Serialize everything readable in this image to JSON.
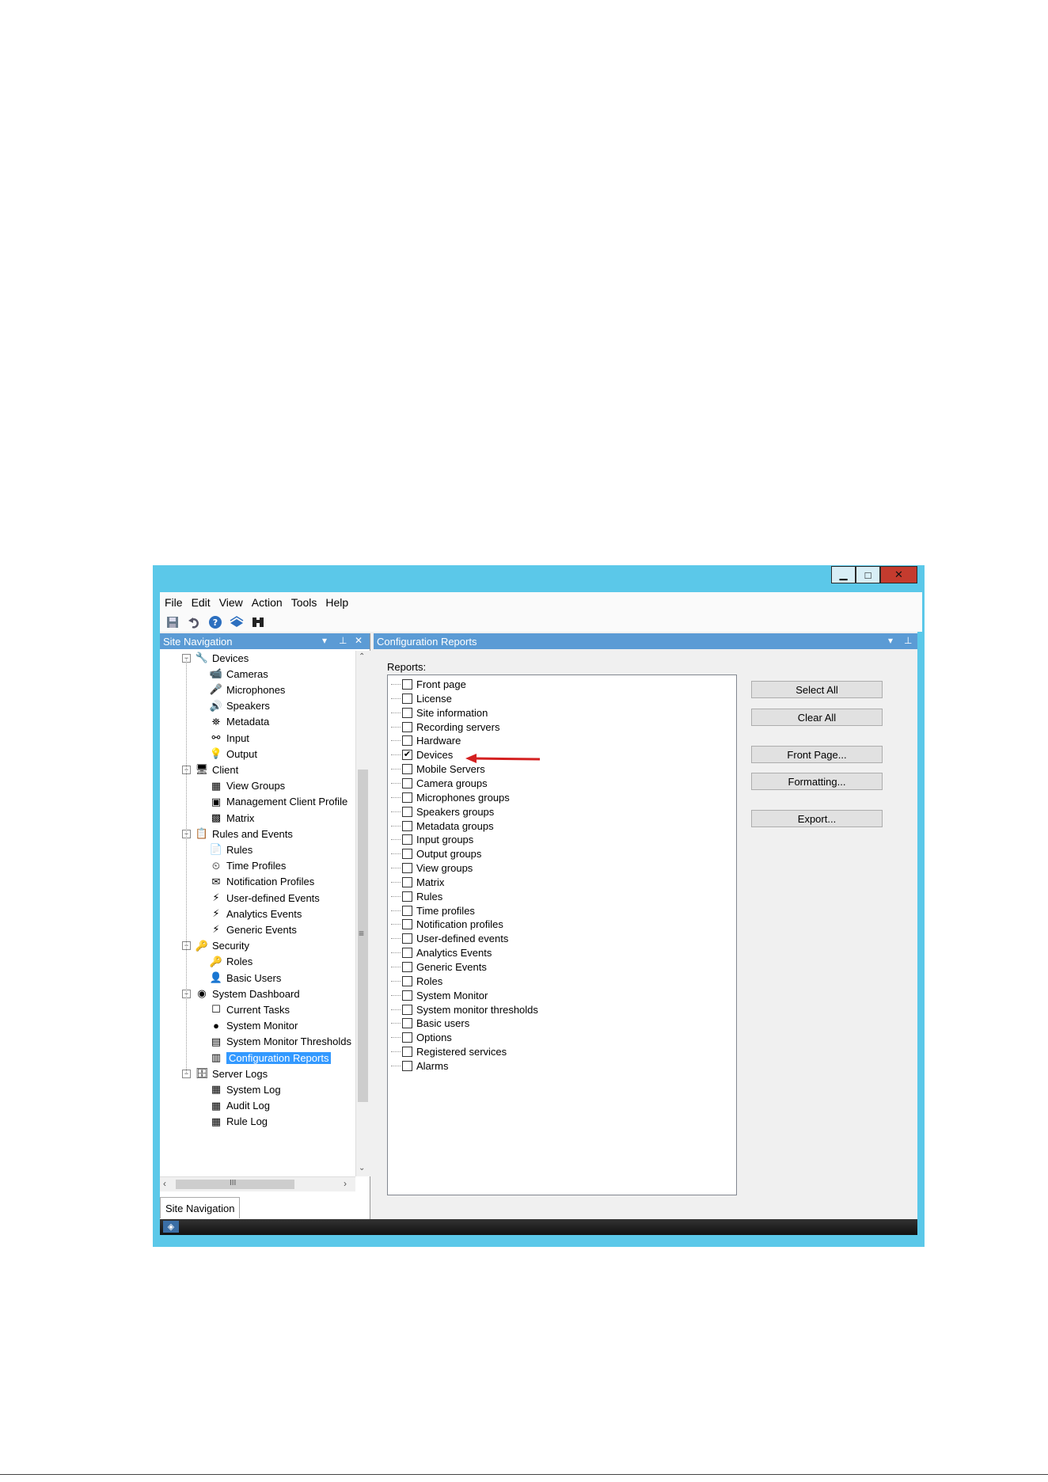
{
  "menu": [
    "File",
    "Edit",
    "View",
    "Action",
    "Tools",
    "Help"
  ],
  "window_controls": {
    "minimize": "▁",
    "maximize": "□",
    "close": "✕"
  },
  "left_pane": {
    "title": "Site Navigation",
    "tab_label": "Site Navigation",
    "tree": [
      {
        "label": "Devices",
        "level": 1,
        "icon": "devices-icon",
        "glyph": "🔧",
        "expander": "−"
      },
      {
        "label": "Cameras",
        "level": 2,
        "icon": "camera-icon",
        "glyph": "📹"
      },
      {
        "label": "Microphones",
        "level": 2,
        "icon": "microphone-icon",
        "glyph": "🎤"
      },
      {
        "label": "Speakers",
        "level": 2,
        "icon": "speaker-icon",
        "glyph": "🔊"
      },
      {
        "label": "Metadata",
        "level": 2,
        "icon": "metadata-icon",
        "glyph": "⛯"
      },
      {
        "label": "Input",
        "level": 2,
        "icon": "input-icon",
        "glyph": "⚯"
      },
      {
        "label": "Output",
        "level": 2,
        "icon": "output-icon",
        "glyph": "💡"
      },
      {
        "label": "Client",
        "level": 1,
        "icon": "client-icon",
        "glyph": "🖥",
        "expander": "−"
      },
      {
        "label": "View Groups",
        "level": 2,
        "icon": "view-groups-icon",
        "glyph": "▦"
      },
      {
        "label": "Management Client Profile",
        "level": 2,
        "icon": "management-client-profile-icon",
        "glyph": "▣"
      },
      {
        "label": "Matrix",
        "level": 2,
        "icon": "matrix-icon",
        "glyph": "▩"
      },
      {
        "label": "Rules and Events",
        "level": 1,
        "icon": "rules-events-icon",
        "glyph": "📋",
        "expander": "−"
      },
      {
        "label": "Rules",
        "level": 2,
        "icon": "rules-icon",
        "glyph": "📄"
      },
      {
        "label": "Time Profiles",
        "level": 2,
        "icon": "time-profiles-icon",
        "glyph": "⏲"
      },
      {
        "label": "Notification Profiles",
        "level": 2,
        "icon": "notification-profiles-icon",
        "glyph": "✉"
      },
      {
        "label": "User-defined Events",
        "level": 2,
        "icon": "user-defined-events-icon",
        "glyph": "⚡"
      },
      {
        "label": "Analytics Events",
        "level": 2,
        "icon": "analytics-events-icon",
        "glyph": "⚡"
      },
      {
        "label": "Generic Events",
        "level": 2,
        "icon": "generic-events-icon",
        "glyph": "⚡"
      },
      {
        "label": "Security",
        "level": 1,
        "icon": "security-icon",
        "glyph": "🔑",
        "expander": "−"
      },
      {
        "label": "Roles",
        "level": 2,
        "icon": "roles-icon",
        "glyph": "🔑"
      },
      {
        "label": "Basic Users",
        "level": 2,
        "icon": "basic-users-icon",
        "glyph": "👤"
      },
      {
        "label": "System Dashboard",
        "level": 1,
        "icon": "system-dashboard-icon",
        "glyph": "◉",
        "expander": "−"
      },
      {
        "label": "Current Tasks",
        "level": 2,
        "icon": "current-tasks-icon",
        "glyph": "☐"
      },
      {
        "label": "System Monitor",
        "level": 2,
        "icon": "system-monitor-icon",
        "glyph": "●"
      },
      {
        "label": "System Monitor Thresholds",
        "level": 2,
        "icon": "system-monitor-thresholds-icon",
        "glyph": "▤"
      },
      {
        "label": "Configuration Reports",
        "level": 2,
        "icon": "configuration-reports-icon",
        "glyph": "▥",
        "selected": true
      },
      {
        "label": "Server Logs",
        "level": 1,
        "icon": "server-logs-icon",
        "glyph": "🗄",
        "expander": "−"
      },
      {
        "label": "System Log",
        "level": 2,
        "icon": "system-log-icon",
        "glyph": "▦"
      },
      {
        "label": "Audit Log",
        "level": 2,
        "icon": "audit-log-icon",
        "glyph": "▦"
      },
      {
        "label": "Rule Log",
        "level": 2,
        "icon": "rule-log-icon",
        "glyph": "▦"
      }
    ],
    "hscroll_grip": "III",
    "vscroll_grip": "≡"
  },
  "right_pane": {
    "title": "Configuration Reports",
    "reports_label": "Reports:",
    "reports": [
      {
        "label": "Front page",
        "checked": false
      },
      {
        "label": "License",
        "checked": false
      },
      {
        "label": "Site information",
        "checked": false
      },
      {
        "label": "Recording servers",
        "checked": false
      },
      {
        "label": "Hardware",
        "checked": false
      },
      {
        "label": "Devices",
        "checked": true
      },
      {
        "label": "Mobile Servers",
        "checked": false
      },
      {
        "label": "Camera groups",
        "checked": false
      },
      {
        "label": "Microphones groups",
        "checked": false
      },
      {
        "label": "Speakers groups",
        "checked": false
      },
      {
        "label": "Metadata groups",
        "checked": false
      },
      {
        "label": "Input groups",
        "checked": false
      },
      {
        "label": "Output groups",
        "checked": false
      },
      {
        "label": "View groups",
        "checked": false
      },
      {
        "label": "Matrix",
        "checked": false
      },
      {
        "label": "Rules",
        "checked": false
      },
      {
        "label": "Time profiles",
        "checked": false
      },
      {
        "label": "Notification profiles",
        "checked": false
      },
      {
        "label": "User-defined events",
        "checked": false
      },
      {
        "label": "Analytics Events",
        "checked": false
      },
      {
        "label": "Generic Events",
        "checked": false
      },
      {
        "label": "Roles",
        "checked": false
      },
      {
        "label": "System Monitor",
        "checked": false
      },
      {
        "label": "System monitor thresholds",
        "checked": false
      },
      {
        "label": "Basic users",
        "checked": false
      },
      {
        "label": "Options",
        "checked": false
      },
      {
        "label": "Registered services",
        "checked": false
      },
      {
        "label": "Alarms",
        "checked": false
      }
    ],
    "buttons": {
      "select_all": "Select All",
      "clear_all": "Clear All",
      "front_page": "Front Page...",
      "formatting": "Formatting...",
      "export": "Export..."
    },
    "annotation_arrow_color": "#d42020"
  },
  "colors": {
    "window_frame": "#5bc8e9",
    "pane_header": "#5b9bd5",
    "selection": "#3399ff",
    "close_button": "#c43b2e"
  }
}
